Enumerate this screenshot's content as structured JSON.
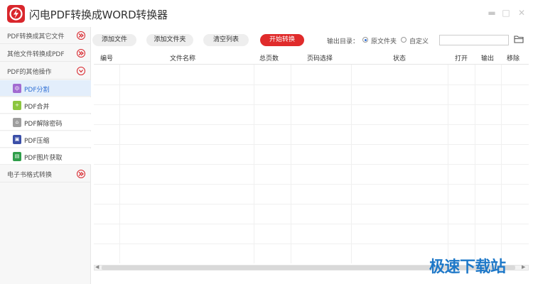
{
  "app": {
    "title": "闪电PDF转换成WORD转换器"
  },
  "colors": {
    "accent": "#e02b2b",
    "active_blue": "#2f6fd4",
    "watermark": "#1e78c8"
  },
  "window_controls": {
    "minimize": "▬",
    "maximize": "□",
    "close": "✕"
  },
  "sidebar": {
    "categories": [
      {
        "label": "PDF转换成其它文件",
        "icon": "chevron-right-icon"
      },
      {
        "label": "其他文件转换成PDF",
        "icon": "chevron-right-icon"
      },
      {
        "label": "PDF的其他操作",
        "icon": "chevron-down-icon"
      },
      {
        "label": "电子书格式转换",
        "icon": "chevron-right-icon"
      }
    ],
    "subitems": [
      {
        "label": "PDF分割",
        "icon": "split-icon",
        "glyph": "中",
        "color": "#a26bd1",
        "active": true
      },
      {
        "label": "PDF合并",
        "icon": "merge-icon",
        "glyph": "+",
        "color": "#8cc63f",
        "active": false
      },
      {
        "label": "PDF解除密码",
        "icon": "unlock-icon",
        "glyph": "⌂",
        "color": "#9e9e9e",
        "active": false
      },
      {
        "label": "PDF压缩",
        "icon": "compress-icon",
        "glyph": "▣",
        "color": "#3b4fa8",
        "active": false
      },
      {
        "label": "PDF图片获取",
        "icon": "image-icon",
        "glyph": "▤",
        "color": "#2f9e4a",
        "active": false
      }
    ]
  },
  "toolbar": {
    "add_file": "添加文件",
    "add_folder": "添加文件夹",
    "clear_list": "清空列表",
    "start": "开始转换",
    "output_label": "输出目录：",
    "radio_original": "原文件夹",
    "radio_custom": "自定义",
    "output_path": ""
  },
  "table": {
    "columns": [
      "编号",
      "文件名称",
      "总页数",
      "页码选择",
      "状态",
      "打开",
      "输出",
      "移除"
    ],
    "rows": []
  },
  "watermark": "极速下载站"
}
